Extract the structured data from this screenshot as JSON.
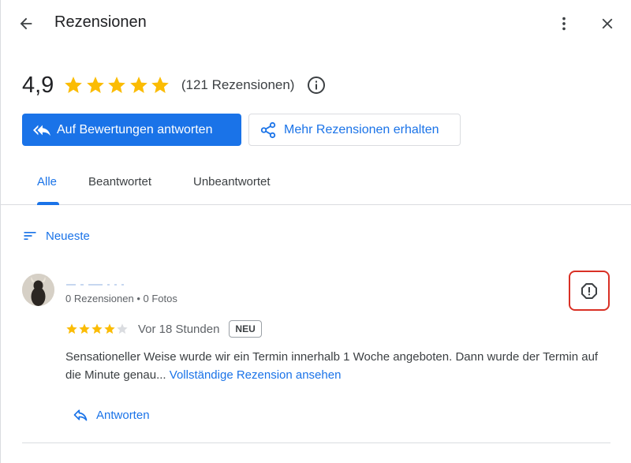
{
  "header": {
    "title": "Rezensionen",
    "back_icon": "arrow-back-icon",
    "more_icon": "more-vert-icon",
    "close_icon": "close-icon"
  },
  "summary": {
    "rating": "4,9",
    "stars": 5,
    "review_count": "(121 Rezensionen)",
    "info_icon": "info-icon"
  },
  "actions": {
    "reply_all_label": "Auf Bewertungen antworten",
    "get_more_label": "Mehr Rezensionen erhalten"
  },
  "tabs": [
    {
      "label": "Alle",
      "active": true
    },
    {
      "label": "Beantwortet",
      "active": false
    },
    {
      "label": "Unbeantwortet",
      "active": false
    }
  ],
  "sort": {
    "label": "Neueste"
  },
  "review": {
    "stats": "0 Rezensionen • 0 Fotos",
    "rating": 4,
    "max_rating": 5,
    "date": "Vor 18 Stunden",
    "badge": "NEU",
    "text": "Sensationeller Weise wurde wir ein Termin innerhalb 1 Woche angeboten. Dann wurde der Termin auf die Minute genau...",
    "full_review_link": "Vollständige Rezension ansehen",
    "reply_label": "Antworten",
    "flag_icon": "report-icon"
  },
  "colors": {
    "accent": "#1a73e8",
    "star": "#fbbc04",
    "star_empty": "#dadce0",
    "highlight": "#d93025"
  }
}
